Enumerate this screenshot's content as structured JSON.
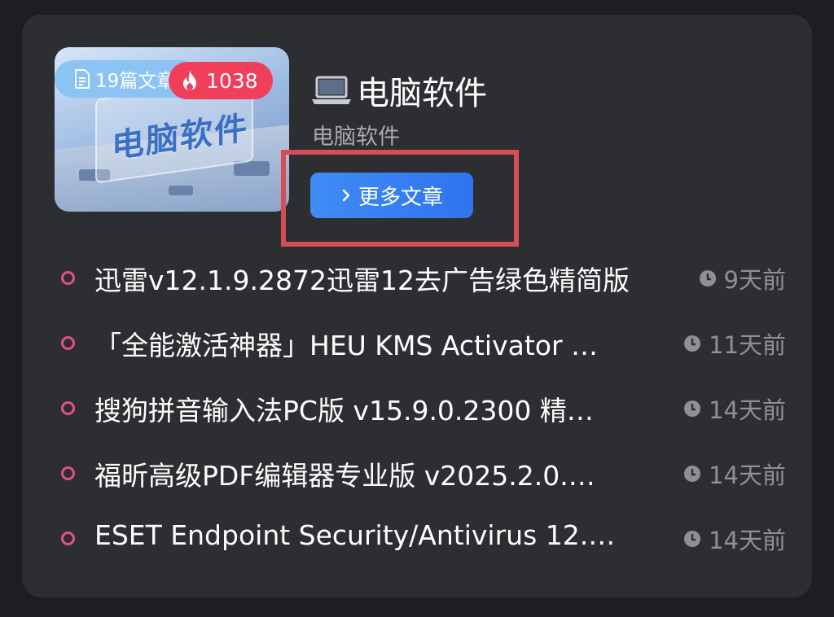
{
  "category": {
    "title": "电脑软件",
    "title_icon": "laptop-icon",
    "subtitle": "电脑软件",
    "article_count_label": "19篇文章",
    "hot_count": "1038",
    "thumbnail_text": "电脑软件",
    "more_button_label": "更多文章"
  },
  "articles": [
    {
      "title": "迅雷v12.1.9.2872迅雷12去广告绿色精简版",
      "time": "9天前"
    },
    {
      "title": "「全能激活神器」HEU KMS Activator …",
      "time": "11天前"
    },
    {
      "title": "搜狗拼音输入法PC版 v15.9.0.2300 精…",
      "time": "14天前"
    },
    {
      "title": "福昕高级PDF编辑器专业版 v2025.2.0.…",
      "time": "14天前"
    },
    {
      "title": "ESET Endpoint Security/Antivirus 12.…",
      "time": "14天前"
    }
  ],
  "colors": {
    "background": "#1d1e21",
    "card": "#2d2e32",
    "accent_blue": "#3f8cf6",
    "hot_red": "#ef3f5b",
    "bullet_pink": "#e0508f",
    "highlight_red": "#d64d55",
    "muted_text": "#8e9096"
  }
}
